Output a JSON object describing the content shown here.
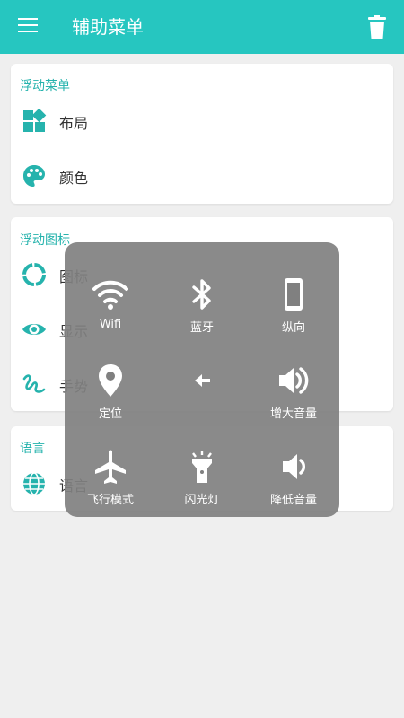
{
  "appbar": {
    "title": "辅助菜单"
  },
  "card1": {
    "title": "浮动菜单",
    "items": [
      {
        "label": "布局",
        "icon": "dashboard-icon"
      },
      {
        "label": "颜色",
        "icon": "palette-icon"
      }
    ]
  },
  "card2": {
    "title": "浮动图标",
    "items": [
      {
        "label": "图标",
        "icon": "ring-icon"
      },
      {
        "label": "显示",
        "icon": "eye-icon"
      },
      {
        "label": "手势",
        "icon": "gesture-icon"
      }
    ]
  },
  "card3": {
    "title": "语言",
    "items": [
      {
        "label": "语言",
        "icon": "globe-icon"
      }
    ]
  },
  "popup": {
    "items": [
      {
        "label": "Wifi",
        "icon": "wifi-icon"
      },
      {
        "label": "蓝牙",
        "icon": "bluetooth-icon"
      },
      {
        "label": "纵向",
        "icon": "portrait-phone-icon"
      },
      {
        "label": "定位",
        "icon": "location-pin-icon"
      },
      {
        "label": "",
        "icon": "back-arrow-icon"
      },
      {
        "label": "增大音量",
        "icon": "volume-up-icon"
      },
      {
        "label": "飞行模式",
        "icon": "airplane-icon"
      },
      {
        "label": "闪光灯",
        "icon": "flashlight-icon"
      },
      {
        "label": "降低音量",
        "icon": "volume-down-icon"
      }
    ]
  },
  "colors": {
    "accent": "#26c6c0",
    "popup_bg": "#808080"
  }
}
